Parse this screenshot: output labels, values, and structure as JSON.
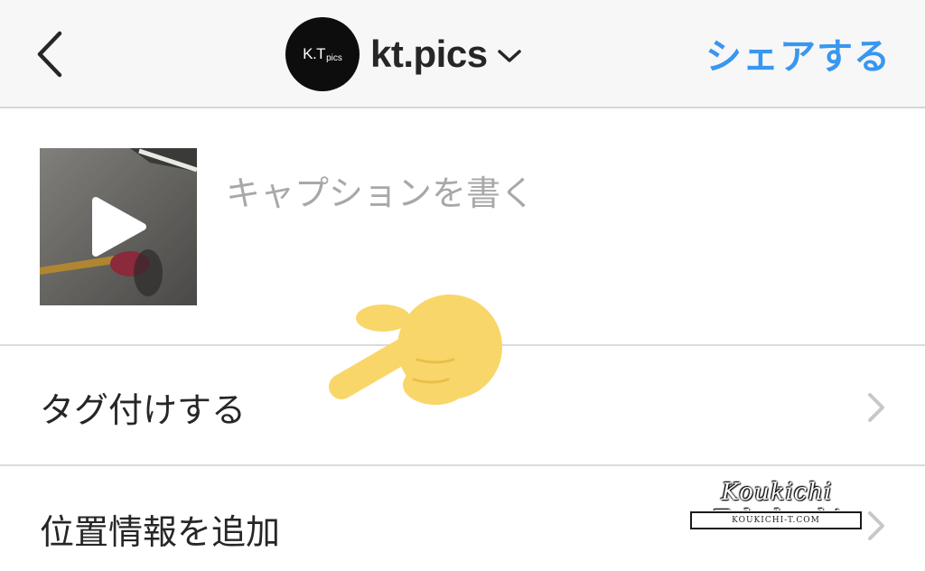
{
  "header": {
    "account": {
      "avatar_text": "K.T",
      "avatar_subtext": "pics",
      "name": "kt.pics"
    },
    "share_label": "シェアする"
  },
  "post": {
    "caption_placeholder": "キャプションを書く",
    "caption_value": ""
  },
  "options": [
    {
      "label": "タグ付けする"
    },
    {
      "label": "位置情報を追加"
    }
  ],
  "watermark": {
    "script": "Koukichi Takahashi",
    "site": "KOUKICHI-T.COM"
  },
  "colors": {
    "accent": "#3897f0",
    "header_bg": "#f7f7f7",
    "divider": "#dbdbdb",
    "placeholder": "#a8a8a8",
    "emoji": "#f8d669"
  },
  "icons": {
    "back": "chevron-left-icon",
    "account_switch": "chevron-down-icon",
    "row_arrow": "chevron-right-icon",
    "play": "play-icon",
    "emoji": "pointing-hand-emoji"
  }
}
